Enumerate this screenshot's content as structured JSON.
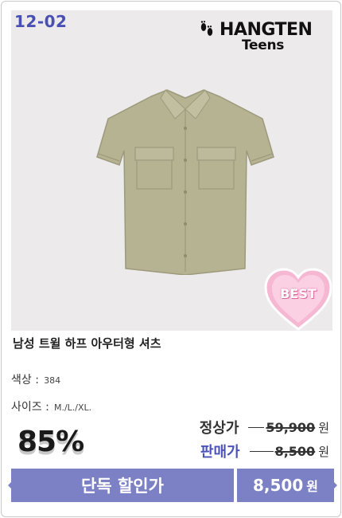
{
  "promo": {
    "date": "12-02"
  },
  "brand": {
    "name": "HANGTEN",
    "sub": "Teens",
    "logo_icon": "footprints-icon"
  },
  "badge": {
    "label": "BEST",
    "color": "#f6b7d2"
  },
  "product": {
    "title": "남성 트윌 하프 아우터형 셔츠",
    "image_icon": "short-sleeve-shirt-icon",
    "shirt_color": "#b6b393",
    "color_label": "색상 :",
    "color_value": "384",
    "size_label": "사이즈 :",
    "size_value": "M./L./XL."
  },
  "pricing": {
    "discount": "85%",
    "regular_label": "정상가",
    "regular_price": "59,900",
    "sale_label": "판매가",
    "sale_price": "8,500",
    "currency": "원"
  },
  "cta": {
    "label": "단독 할인가",
    "price": "8,500",
    "currency": "원",
    "color": "#7c80c4"
  },
  "colors": {
    "accent": "#4a4fb4"
  }
}
